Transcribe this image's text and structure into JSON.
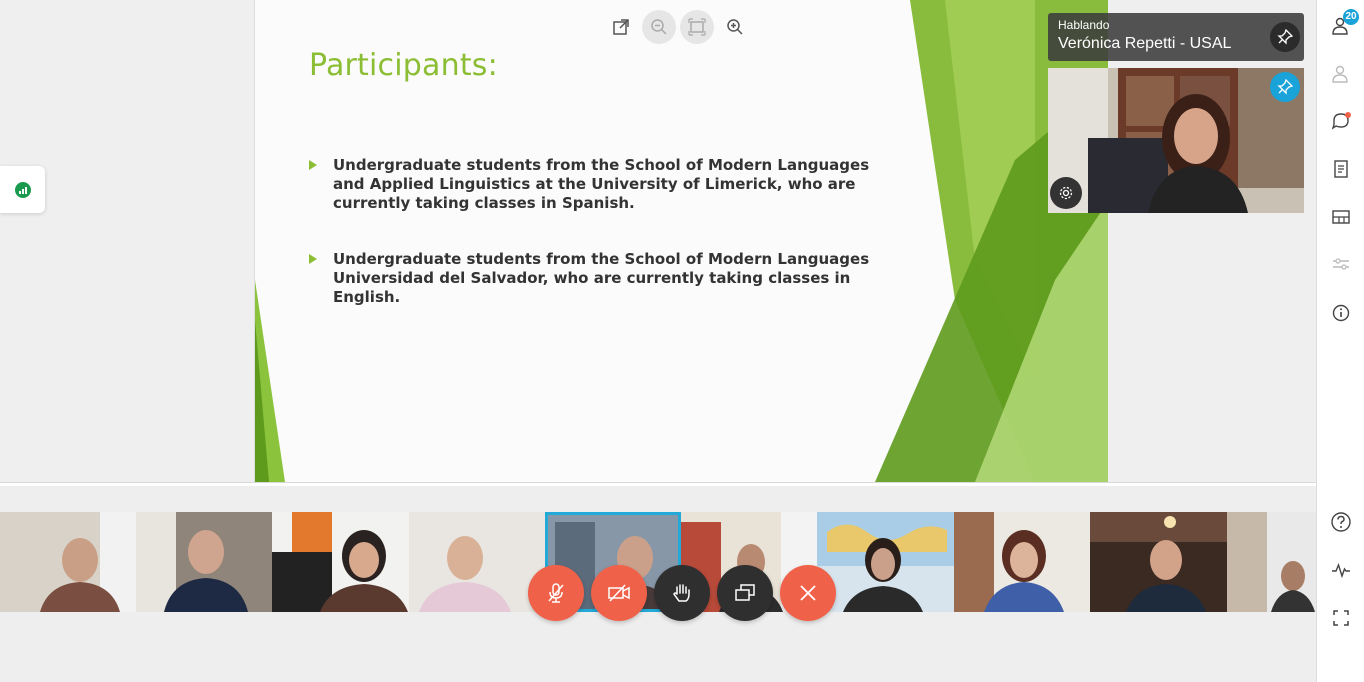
{
  "slide": {
    "title": "Participants:",
    "bullets": [
      "Undergraduate students from the School of Modern Languages and Applied Linguistics at the University of Limerick, who are currently taking classes in Spanish.",
      "Undergraduate students from the School of Modern Languages Universidad del Salvador, who are currently taking classes in English."
    ],
    "accent_color": "#8bbd35"
  },
  "zoom_tools": [
    "external-link-icon",
    "zoom-out-icon",
    "fit-screen-icon",
    "zoom-in-icon"
  ],
  "speaker": {
    "status": "Hablando",
    "name": "Verónica Repetti - USAL"
  },
  "participants": {
    "count": "20",
    "thumbnail_count": 10
  },
  "controls": [
    "mute-mic-button",
    "stop-camera-button",
    "raise-hand-button",
    "share-screen-button",
    "leave-call-button"
  ],
  "rail": {
    "top_icons": [
      "participants-icon",
      "add-user-icon",
      "chat-icon",
      "notes-icon",
      "layout-icon",
      "settings-sliders-icon",
      "info-icon"
    ],
    "bottom_icons": [
      "help-icon",
      "stats-icon",
      "fullscreen-icon"
    ]
  },
  "colors": {
    "danger": "#f0614a",
    "dark_button": "#2f2f2f",
    "active": "#22a9d7",
    "brand_green": "#8bbd35"
  }
}
